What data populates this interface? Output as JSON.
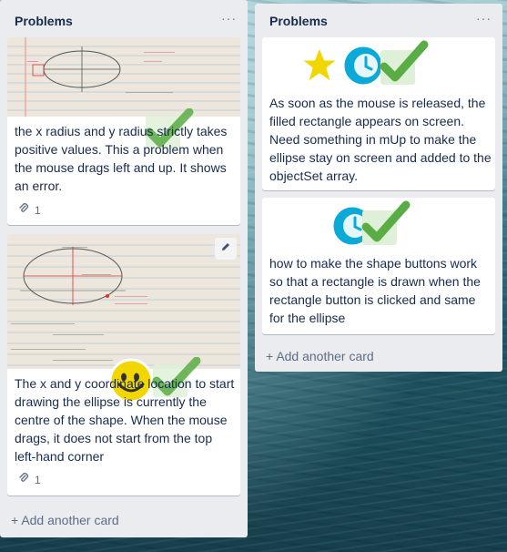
{
  "lists": [
    {
      "title": "Problems",
      "menu_label": "···",
      "add_card_label": "Add another card",
      "add_icon": "plus-icon",
      "cards": [
        {
          "text": "the x radius and y radius strictly takes positive values. This a problem when the mouse drags left and up. It shows an error.",
          "attachment_count": "1",
          "attachment_icon": "paperclip-icon",
          "stickers": [
            "check-icon"
          ]
        },
        {
          "text": "The x and y coordinate location to start drawing the ellipse is currently the centre of the shape. When the mouse drags, it does not start from the top left-hand corner",
          "attachment_count": "1",
          "attachment_icon": "paperclip-icon",
          "edit_icon": "pencil-icon",
          "stickers": [
            "smiley-icon",
            "check-icon"
          ]
        }
      ]
    },
    {
      "title": "Problems",
      "menu_label": "···",
      "add_card_label": "Add another card",
      "add_icon": "plus-icon",
      "cards": [
        {
          "text": "As soon as the mouse is released, the filled rectangle appears on screen. Need something in mUp to make the ellipse stay on screen and added to the objectSet array.",
          "stickers": [
            "star-icon",
            "clock-icon",
            "check-icon"
          ]
        },
        {
          "text": "how to make the shape buttons work so that a rectangle is drawn when the rectangle button is clicked and same for the ellipse",
          "stickers": [
            "clock-icon",
            "check-icon"
          ]
        }
      ]
    }
  ],
  "colors": {
    "list_bg": "#ebecf0",
    "card_bg": "#ffffff",
    "title_text": "#172b4d",
    "muted_text": "#5e6c84",
    "check_green": "#5aac44",
    "star_yellow": "#f2d600",
    "clock_blue": "#0aa9d8"
  }
}
